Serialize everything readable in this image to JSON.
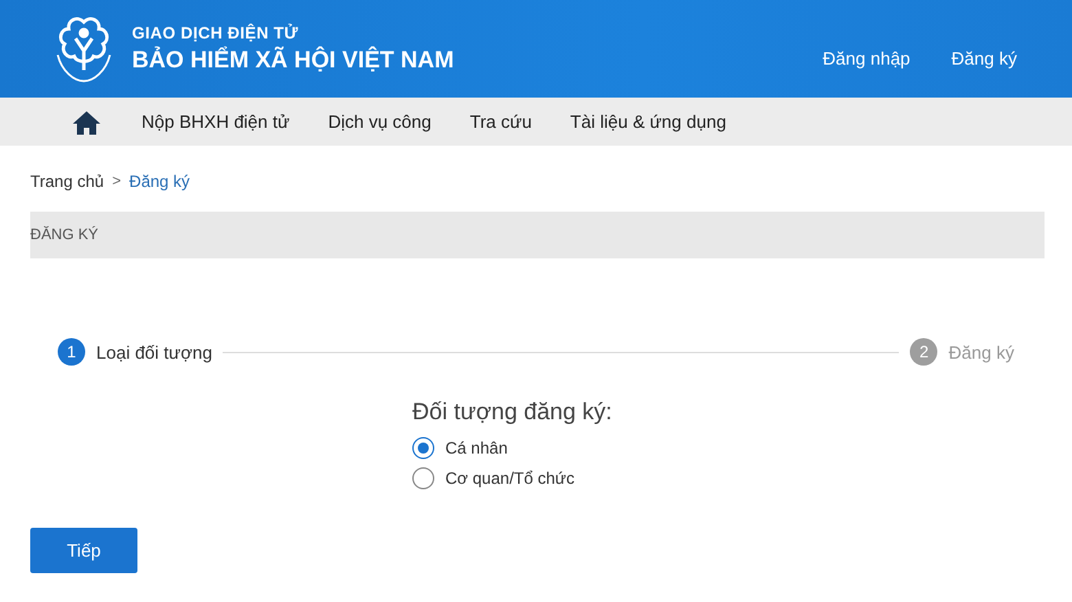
{
  "header": {
    "title_top": "GIAO DỊCH ĐIỆN TỬ",
    "title_main": "BẢO HIỂM XÃ HỘI VIỆT NAM",
    "links": [
      "Đăng nhập",
      "Đăng ký"
    ]
  },
  "nav": {
    "items": [
      "Nộp BHXH điện tử",
      "Dịch vụ công",
      "Tra cứu",
      "Tài liệu & ứng dụng"
    ]
  },
  "breadcrumb": {
    "home": "Trang chủ",
    "separator": ">",
    "current": "Đăng ký"
  },
  "section_title": "ĐĂNG KÝ",
  "steps": [
    {
      "number": "1",
      "label": "Loại đối tượng",
      "active": true
    },
    {
      "number": "2",
      "label": "Đăng ký",
      "active": false
    }
  ],
  "form": {
    "label": "Đối tượng đăng ký:",
    "options": [
      {
        "label": "Cá nhân",
        "selected": true
      },
      {
        "label": "Cơ quan/Tổ chức",
        "selected": false
      }
    ]
  },
  "next_button": "Tiếp"
}
